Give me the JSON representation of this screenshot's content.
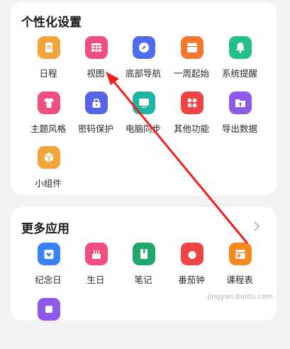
{
  "personalization": {
    "title": "个性化设置",
    "items": [
      {
        "label": "日程",
        "color": "#f3a53c",
        "icon": "document-icon"
      },
      {
        "label": "视图",
        "color": "#ee4f7e",
        "icon": "grid-icon"
      },
      {
        "label": "底部导航",
        "color": "#4f6cf0",
        "icon": "compass-icon"
      },
      {
        "label": "一周起始",
        "color": "#f5762f",
        "icon": "calendar-icon"
      },
      {
        "label": "系统提醒",
        "color": "#22c08c",
        "icon": "bell-icon"
      },
      {
        "label": "主题风格",
        "color": "#ee4f7e",
        "icon": "shirt-icon"
      },
      {
        "label": "密码保护",
        "color": "#5a64e8",
        "icon": "lock-icon"
      },
      {
        "label": "电脑同步",
        "color": "#1db5a5",
        "icon": "monitor-icon"
      },
      {
        "label": "其他功能",
        "color": "#f04545",
        "icon": "apps-icon"
      },
      {
        "label": "导出数据",
        "color": "#8f5ae8",
        "icon": "export-icon"
      },
      {
        "label": "小组件",
        "color": "#f3a53c",
        "icon": "widget-icon"
      }
    ]
  },
  "more_apps": {
    "title": "更多应用",
    "items": [
      {
        "label": "纪念日",
        "color": "#3b82f6",
        "icon": "heart-calendar-icon"
      },
      {
        "label": "生日",
        "color": "#ee4f7e",
        "icon": "cake-icon"
      },
      {
        "label": "笔记",
        "color": "#1fa86a",
        "icon": "notebook-icon"
      },
      {
        "label": "番茄钟",
        "color": "#f04545",
        "icon": "tomato-icon"
      },
      {
        "label": "课程表",
        "color": "#f5881f",
        "icon": "timetable-icon"
      },
      {
        "label": "",
        "color": "#8f5ae8",
        "icon": "app-icon"
      }
    ]
  },
  "watermark": "jingyan.baidu.com"
}
